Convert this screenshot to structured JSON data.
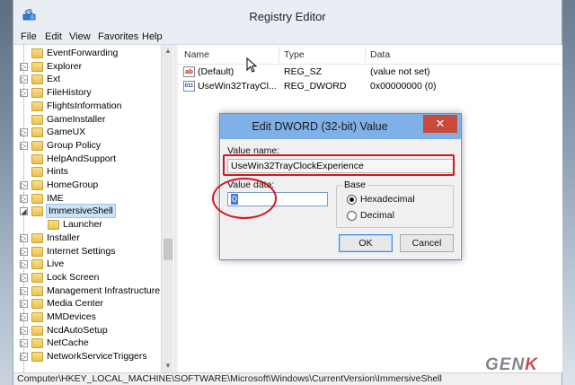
{
  "window": {
    "title": "Registry Editor"
  },
  "menu": [
    "File",
    "Edit",
    "View",
    "Favorites",
    "Help"
  ],
  "tree": [
    {
      "label": "EventForwarding",
      "expander": ""
    },
    {
      "label": "Explorer",
      "expander": "▷"
    },
    {
      "label": "Ext",
      "expander": "▷"
    },
    {
      "label": "FileHistory",
      "expander": "▷"
    },
    {
      "label": "FlightsInformation",
      "expander": ""
    },
    {
      "label": "GameInstaller",
      "expander": ""
    },
    {
      "label": "GameUX",
      "expander": "▷"
    },
    {
      "label": "Group Policy",
      "expander": "▷"
    },
    {
      "label": "HelpAndSupport",
      "expander": ""
    },
    {
      "label": "Hints",
      "expander": ""
    },
    {
      "label": "HomeGroup",
      "expander": "▷"
    },
    {
      "label": "IME",
      "expander": "▷"
    },
    {
      "label": "ImmersiveShell",
      "expander": "◢",
      "selected": true
    },
    {
      "label": "Launcher",
      "expander": "",
      "child": true
    },
    {
      "label": "Installer",
      "expander": "▷"
    },
    {
      "label": "Internet Settings",
      "expander": "▷"
    },
    {
      "label": "Live",
      "expander": "▷"
    },
    {
      "label": "Lock Screen",
      "expander": "▷"
    },
    {
      "label": "Management Infrastructure",
      "expander": "▷"
    },
    {
      "label": "Media Center",
      "expander": "▷"
    },
    {
      "label": "MMDevices",
      "expander": "▷"
    },
    {
      "label": "NcdAutoSetup",
      "expander": "▷"
    },
    {
      "label": "NetCache",
      "expander": "▷"
    },
    {
      "label": "NetworkServiceTriggers",
      "expander": "▷"
    }
  ],
  "list": {
    "headers": {
      "name": "Name",
      "type": "Type",
      "data": "Data"
    },
    "rows": [
      {
        "icon": "ab",
        "icon_name": "string-value-icon",
        "name": "(Default)",
        "type": "REG_SZ",
        "data": "(value not set)"
      },
      {
        "icon": "011",
        "icon_name": "binary-value-icon",
        "name": "UseWin32TrayCl...",
        "type": "REG_DWORD",
        "data": "0x00000000 (0)"
      }
    ]
  },
  "statusbar": {
    "path": "Computer\\HKEY_LOCAL_MACHINE\\SOFTWARE\\Microsoft\\Windows\\CurrentVersion\\ImmersiveShell"
  },
  "dialog": {
    "title": "Edit DWORD (32-bit) Value",
    "close_glyph": "✕",
    "value_name_label": "Value name:",
    "value_name": "UseWin32TrayClockExperience",
    "value_data_label": "Value data:",
    "value_data": "0",
    "base_label": "Base",
    "hex_label": "Hexadecimal",
    "dec_label": "Decimal",
    "base_selected": "Hexadecimal",
    "ok_label": "OK",
    "cancel_label": "Cancel"
  },
  "annotations": {
    "color": "#d3151f"
  },
  "watermark": {
    "text_a": "GEN",
    "text_b": "K"
  }
}
